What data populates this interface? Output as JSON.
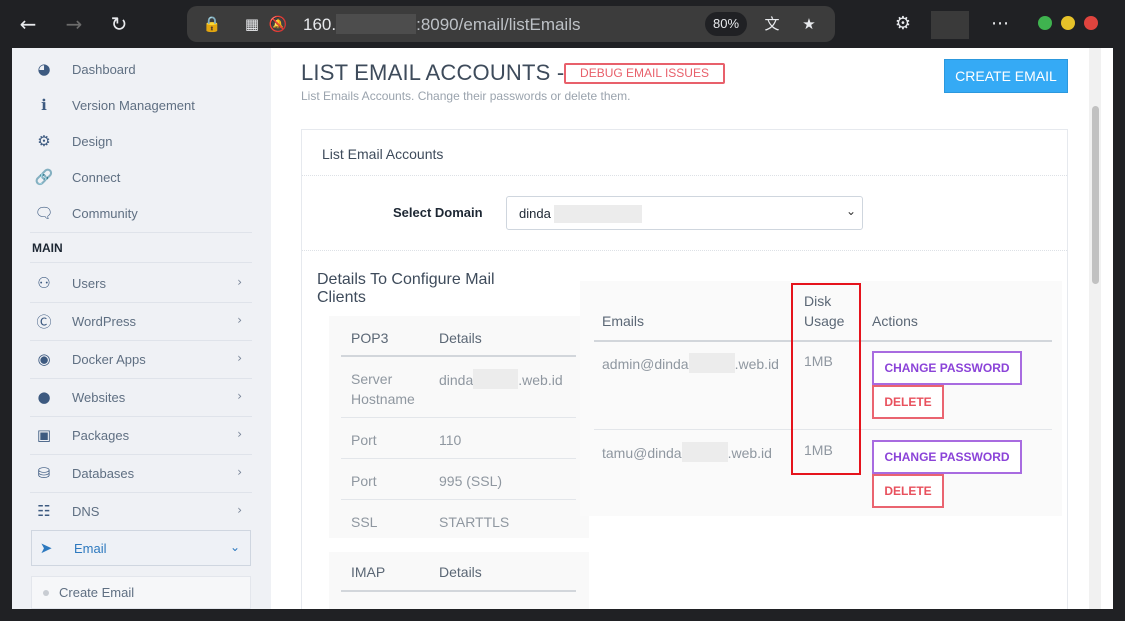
{
  "browser": {
    "url_host": "160.",
    "url_rest": ":8090/email/listEmails",
    "zoom": "80%",
    "icons": [
      "back-arrow-icon",
      "forward-arrow-icon",
      "reload-icon",
      "lock-icon",
      "reader-icon",
      "bell-off-icon",
      "translate-icon",
      "bookmark-icon",
      "extensions-icon",
      "more-icon"
    ]
  },
  "sidebar": {
    "items": [
      {
        "label": "Dashboard",
        "icon": "dashboard-icon"
      },
      {
        "label": "Version Management",
        "icon": "info-icon"
      },
      {
        "label": "Design",
        "icon": "gear-icon"
      },
      {
        "label": "Connect",
        "icon": "link-icon"
      },
      {
        "label": "Community",
        "icon": "chat-icon"
      }
    ],
    "heading": "MAIN",
    "main_items": [
      {
        "label": "Users",
        "icon": "users-icon"
      },
      {
        "label": "WordPress",
        "icon": "wordpress-icon"
      },
      {
        "label": "Docker Apps",
        "icon": "docker-icon"
      },
      {
        "label": "Websites",
        "icon": "globe-icon"
      },
      {
        "label": "Packages",
        "icon": "cubes-icon"
      },
      {
        "label": "Databases",
        "icon": "database-icon"
      },
      {
        "label": "DNS",
        "icon": "sitemap-icon"
      }
    ],
    "active": {
      "label": "Email",
      "icon": "paper-plane-icon"
    },
    "sub_item": "Create Email"
  },
  "header": {
    "title": "LIST EMAIL ACCOUNTS -",
    "debug_button": "DEBUG EMAIL ISSUES",
    "subtitle": "List Emails Accounts. Change their passwords or delete them.",
    "create_button": "CREATE EMAIL"
  },
  "card": {
    "title": "List Email Accounts",
    "select_label": "Select Domain",
    "select_value": "dinda"
  },
  "details": {
    "title": "Details To Configure Mail Clients",
    "pop3": {
      "headers": [
        "POP3",
        "Details"
      ],
      "rows": [
        [
          "Server Hostname",
          "dinda",
          ".web.id"
        ],
        [
          "Port",
          "110"
        ],
        [
          "Port",
          "995 (SSL)"
        ],
        [
          "SSL",
          "STARTTLS"
        ]
      ]
    },
    "imap": {
      "headers": [
        "IMAP",
        "Details"
      ]
    }
  },
  "emails": {
    "headers": [
      "Emails",
      "Disk Usage",
      "Actions"
    ],
    "rows": [
      {
        "prefix": "admin@dinda",
        "suffix": ".web.id",
        "usage": "1MB"
      },
      {
        "prefix": "tamu@dinda",
        "suffix": ".web.id",
        "usage": "1MB"
      }
    ],
    "change_label": "CHANGE PASSWORD",
    "delete_label": "DELETE"
  }
}
